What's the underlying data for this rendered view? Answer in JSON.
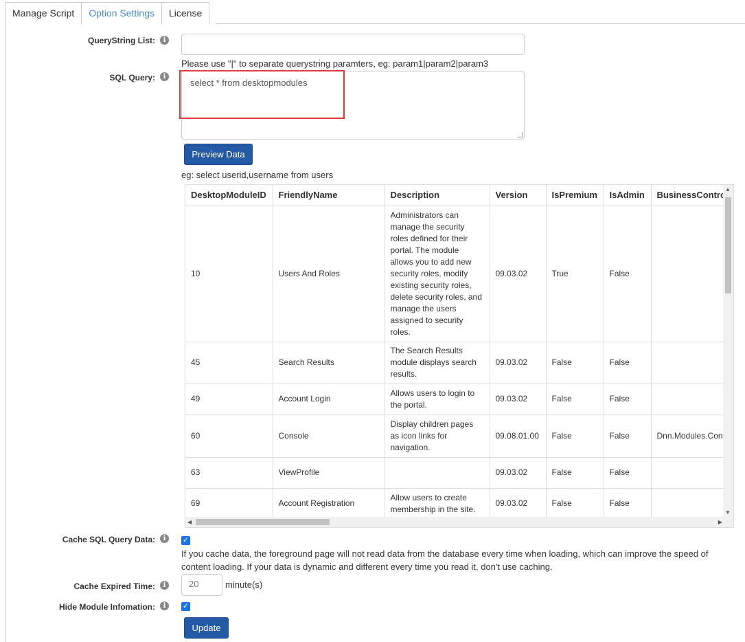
{
  "tabs": [
    {
      "label": "Manage Script",
      "active": false
    },
    {
      "label": "Option Settings",
      "active": true
    },
    {
      "label": "License",
      "active": false
    }
  ],
  "querystring": {
    "label": "QueryString List:",
    "value": "",
    "help": "Please use \"|\" to separate querystring paramters, eg: param1|param2|param3"
  },
  "sql": {
    "label": "SQL Query:",
    "value": "select * from desktopmodules",
    "preview_button": "Preview Data",
    "example": "eg: select userid,username from users"
  },
  "grid": {
    "columns": [
      "DesktopModuleID",
      "FriendlyName",
      "Description",
      "Version",
      "IsPremium",
      "IsAdmin",
      "BusinessControl"
    ],
    "rows": [
      {
        "id": "10",
        "name": "Users And Roles",
        "desc": "Administrators can manage the security roles defined for their portal. The module allows you to add new security roles, modify existing security roles, delete security roles, and manage the users assigned to security roles.",
        "version": "09.03.02",
        "premium": "True",
        "admin": "False",
        "bc": ""
      },
      {
        "id": "45",
        "name": "Search Results",
        "desc": "The Search Results module displays search results.",
        "version": "09.03.02",
        "premium": "False",
        "admin": "False",
        "bc": ""
      },
      {
        "id": "49",
        "name": "Account Login",
        "desc": "Allows users to login to the portal.",
        "version": "09.03.02",
        "premium": "False",
        "admin": "False",
        "bc": ""
      },
      {
        "id": "60",
        "name": "Console",
        "desc": "Display children pages as icon links for navigation.",
        "version": "09.08.01.00",
        "premium": "False",
        "admin": "False",
        "bc": "Dnn.Modules.Con"
      },
      {
        "id": "63",
        "name": "ViewProfile",
        "desc": "",
        "version": "09.03.02",
        "premium": "False",
        "admin": "False",
        "bc": ""
      },
      {
        "id": "69",
        "name": "Account Registration",
        "desc": "Allow users to create membership in the site.",
        "version": "09.03.02",
        "premium": "False",
        "admin": "False",
        "bc": ""
      }
    ]
  },
  "cache": {
    "label": "Cache SQL Query Data:",
    "checked": true,
    "help_line1": "If you cache data, the foreground page will not read data from the database every time when loading, which can improve the speed of",
    "help_line2": "content loading. If your data is dynamic and different every time you read it, don't use caching."
  },
  "expire": {
    "label": "Cache Expired Time:",
    "value": "20",
    "unit": "minute(s)"
  },
  "hide": {
    "label": "Hide Module Infomation:",
    "checked": true
  },
  "update_button": "Update",
  "colors": {
    "accent": "#2459a5",
    "active_tab": "#4a8fc8",
    "highlight_box": "#e03b3b"
  }
}
